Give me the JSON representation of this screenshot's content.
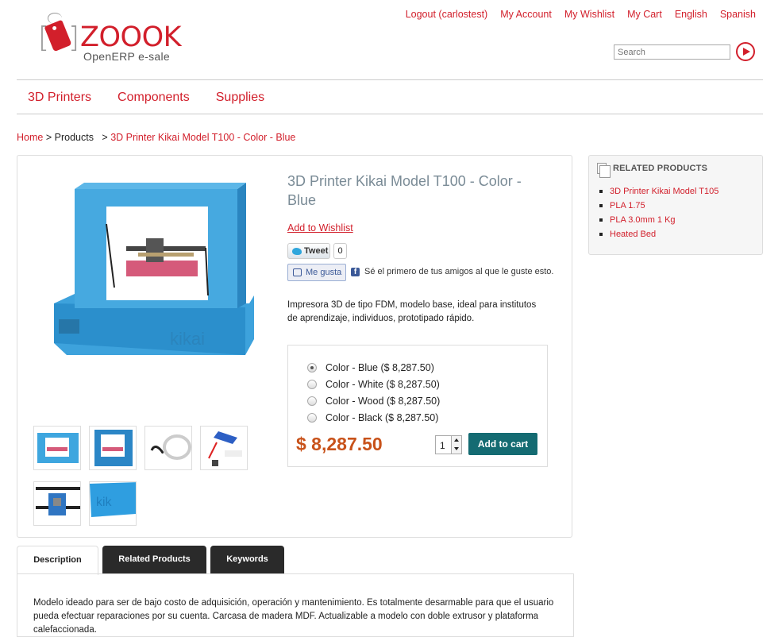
{
  "header": {
    "top_links": [
      "Logout (carlostest)",
      "My Account",
      "My Wishlist",
      "My Cart",
      "English",
      "Spanish"
    ],
    "logo_word": "ZOOOK",
    "logo_sub": "OpenERP  e-sale",
    "search_placeholder": "Search"
  },
  "nav": {
    "items": [
      "3D Printers",
      "Components",
      "Supplies"
    ]
  },
  "breadcrumb": {
    "home": "Home",
    "sep": ">",
    "products": "Products",
    "current": "3D Printer Kikai Model T100 - Color - Blue"
  },
  "product": {
    "title": "3D Printer Kikai Model T100 - Color - Blue",
    "wishlist": "Add to Wishlist",
    "tweet_label": "Tweet",
    "tweet_count": "0",
    "like_label": "Me gusta",
    "fb_text": "Sé el primero de tus amigos al que le guste esto.",
    "short_description": "Impresora 3D de tipo FDM, modelo base, ideal para institutos de aprendizaje, individuos, prototipado rápido.",
    "variants": [
      {
        "label": "Color - Blue ($ 8,287.50)",
        "selected": true
      },
      {
        "label": "Color - White ($ 8,287.50)",
        "selected": false
      },
      {
        "label": "Color - Wood ($ 8,287.50)",
        "selected": false
      },
      {
        "label": "Color - Black ($ 8,287.50)",
        "selected": false
      }
    ],
    "price": "$ 8,287.50",
    "quantity": "1",
    "add_to_cart": "Add to cart"
  },
  "related": {
    "heading": "RELATED PRODUCTS",
    "items": [
      "3D Printer Kikai Model T105",
      "PLA 1.75",
      "PLA 3.0mm 1 Kg",
      "Heated Bed"
    ]
  },
  "tabs": {
    "items": [
      "Description",
      "Related Products",
      "Keywords"
    ],
    "active": "Description",
    "description": "Modelo ideado para ser de bajo costo de adquisición, operación y mantenimiento. Es totalmente desarmable para que el usuario pueda efectuar reparaciones por su cuenta. Carcasa de madera MDF. Actualizable a modelo con doble extrusor y plataforma calefaccionada."
  },
  "colors": {
    "accent": "#d21f2b",
    "price": "#c8521a",
    "cart_button": "#146b72",
    "title": "#7a8b96"
  }
}
